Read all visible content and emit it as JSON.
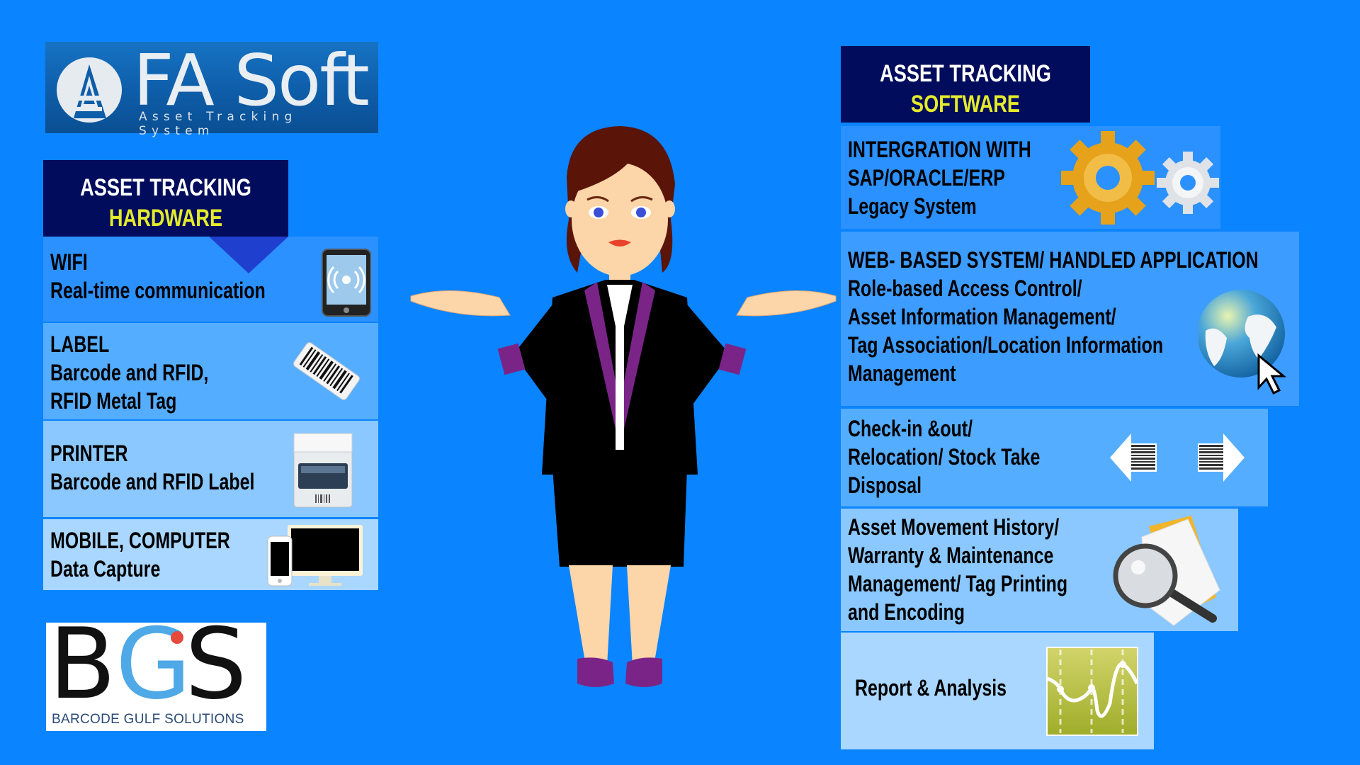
{
  "brand": {
    "fa_soft": {
      "name": "FA Soft",
      "tagline": "Asset Tracking System"
    },
    "bgs": {
      "letters": [
        "B",
        "G",
        "S"
      ],
      "full_name": "BARCODE GULF SOLUTIONS"
    }
  },
  "hardware": {
    "header_line1": "ASSET TRACKING",
    "header_line2": "HARDWARE",
    "items": [
      {
        "title": "WIFI",
        "lines": [
          "Real-time communication"
        ],
        "icon": "tablet-wifi-icon"
      },
      {
        "title": "LABEL",
        "lines": [
          "Barcode and RFID,",
          "RFID Metal Tag"
        ],
        "icon": "barcode-label-icon"
      },
      {
        "title": "PRINTER",
        "lines": [
          "Barcode and RFID Label"
        ],
        "icon": "printer-icon"
      },
      {
        "title": "MOBILE, COMPUTER",
        "lines": [
          "Data Capture"
        ],
        "icon": "mobile-computer-icon"
      }
    ]
  },
  "software": {
    "header_line1": "ASSET TRACKING",
    "header_line2": "SOFTWARE",
    "items": [
      {
        "lines": [
          "INTERGRATION WITH",
          "SAP/ORACLE/ERP",
          "Legacy System"
        ],
        "icon": "gears-icon"
      },
      {
        "lines": [
          "WEB- BASED SYSTEM/ HANDLED APPLICATION",
          "Role-based Access Control/",
          "Asset Information Management/",
          "Tag Association/Location Information",
          "Management"
        ],
        "icon": "globe-cursor-icon"
      },
      {
        "lines": [
          "Check-in &out/",
          "Relocation/ Stock Take",
          "Disposal"
        ],
        "icon": "barcode-arrows-icon"
      },
      {
        "lines": [
          "Asset Movement History/",
          "Warranty & Maintenance",
          "Management/ Tag Printing",
          "and Encoding"
        ],
        "icon": "magnifier-document-icon"
      },
      {
        "lines": [
          "Report & Analysis"
        ],
        "icon": "line-chart-icon"
      }
    ]
  },
  "colors": {
    "background": "#0a84ff",
    "header_bg": "#020c5c",
    "header_accent": "#e4eb2b",
    "row_dark": "#2b91ff",
    "row_mid": "#55adff",
    "row_light": "#8ac8ff",
    "row_lightest": "#a9d7ff"
  }
}
